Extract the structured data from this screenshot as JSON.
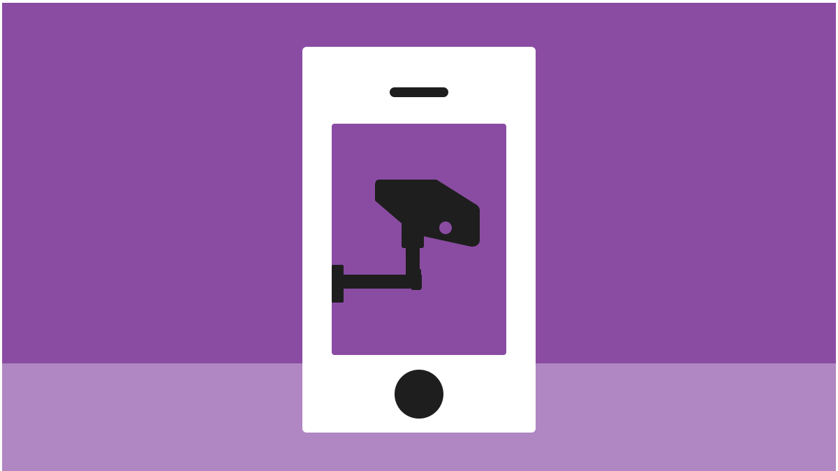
{
  "colors": {
    "page_background": "#ffffff",
    "wall": "#8a4ca3",
    "floor": "#b087c2",
    "phone_body": "#ffffff",
    "screen": "#8a4ca3",
    "icon": "#1e1e1e"
  },
  "illustration": {
    "subject": "smartphone-icon",
    "screen_content": "security-camera-icon"
  }
}
